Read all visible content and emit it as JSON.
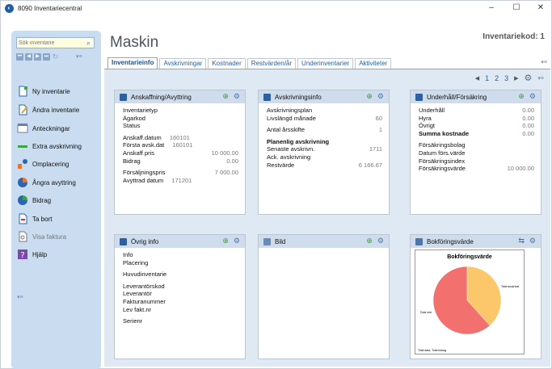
{
  "window": {
    "title": "8090 Inventariecentral",
    "app_icon": "app-logo-icon",
    "minimize": "–",
    "maximize": "☐",
    "close": "✕"
  },
  "sidebar": {
    "search_placeholder": "Sök inventarie",
    "items": [
      {
        "label": "Ny inventarie",
        "icon": "new-document-icon"
      },
      {
        "label": "Ändra inventarie",
        "icon": "edit-document-icon"
      },
      {
        "label": "Anteckningar",
        "icon": "notes-icon"
      },
      {
        "label": "Extra avskrivning",
        "icon": "extra-depreciation-icon"
      },
      {
        "label": "Omplacering",
        "icon": "relocation-icon"
      },
      {
        "label": "Ångra avyttring",
        "icon": "undo-disposal-icon"
      },
      {
        "label": "Bidrag",
        "icon": "grant-icon"
      },
      {
        "label": "Ta bort",
        "icon": "delete-icon"
      },
      {
        "label": "Visa faktura",
        "icon": "invoice-icon"
      },
      {
        "label": "Hjälp",
        "icon": "help-icon"
      }
    ]
  },
  "main": {
    "title": "Maskin",
    "inventory_code": "Inventariekod: 1",
    "tabs": [
      "Inventarieinfo",
      "Avskrivningar",
      "Kostnader",
      "Restvärden/år",
      "Underinventarier",
      "Aktiviteter"
    ],
    "pager": {
      "pages": [
        "1",
        "2",
        "3"
      ]
    }
  },
  "panels": {
    "anskaffning": {
      "title": "Anskaffning/Avyttring",
      "rows1": [
        {
          "k": "Inventarietyp"
        },
        {
          "k": "Ägarkod"
        },
        {
          "k": "Status"
        }
      ],
      "rows2": [
        {
          "k": "Anskaff.datum",
          "m": "160101"
        },
        {
          "k": "Första avsk.dat",
          "m": "160101"
        },
        {
          "k": "Anskaff.pris",
          "v": "10 000.00"
        },
        {
          "k": "Bidrag",
          "v": "0.00"
        }
      ],
      "rows3": [
        {
          "k": "Försäljningspris",
          "v": "7 000.00"
        },
        {
          "k": "Avyttrad datum",
          "m": "171201"
        }
      ]
    },
    "avskrivning": {
      "title": "Avskrivningsinfo",
      "rows1": [
        {
          "k": "Avskrivningsplan"
        },
        {
          "k": "Livslängd månade",
          "v": "60"
        }
      ],
      "rows2": [
        {
          "k": "Antal årsskifte",
          "v": "1"
        }
      ],
      "rows3": [
        {
          "k": "Planenlig avskrivning",
          "b": true
        },
        {
          "k": "Senaste avskrivn.",
          "v": "1711"
        },
        {
          "k": "Ack. avskrivning"
        },
        {
          "k": "Restvärde",
          "v": "6 166.67"
        }
      ]
    },
    "underhall": {
      "title": "Underhåll/Försäkring",
      "rows1": [
        {
          "k": "Underhåll",
          "v": "0.00"
        },
        {
          "k": "Hyra",
          "v": "0.00"
        },
        {
          "k": "Övrigt",
          "v": "0.00"
        },
        {
          "k": "Summa kostnade",
          "v": "0.00",
          "b": true
        }
      ],
      "rows2": [
        {
          "k": "Försäkringsbolag"
        },
        {
          "k": "Datum förs.värde"
        },
        {
          "k": "Försäkringsindex"
        },
        {
          "k": "Försäkringsvärde",
          "v": "10 000.00"
        }
      ]
    },
    "ovrig": {
      "title": "Övrig info",
      "rows1": [
        {
          "k": "Info"
        },
        {
          "k": "Placering"
        }
      ],
      "rows2": [
        {
          "k": "Huvudinventarie"
        }
      ],
      "rows3": [
        {
          "k": "Leverantörskod"
        },
        {
          "k": "Leverantör"
        },
        {
          "k": "Fakturanummer"
        },
        {
          "k": "Lev fakt.nr"
        }
      ],
      "rows4": [
        {
          "k": "Serienr"
        }
      ]
    },
    "bild": {
      "title": "Bild"
    },
    "bokforing": {
      "title": "Bokföringsvärde"
    }
  },
  "chart_data": {
    "type": "pie",
    "title": "Bokföringsvärde",
    "slices": [
      {
        "label": "Total avskrivat",
        "value": 38.3,
        "color": "#fcc66a"
      },
      {
        "label": "Total rest",
        "value": 61.7,
        "color": "#f2716f"
      }
    ],
    "footnote": "Total data, Total bidrag"
  }
}
